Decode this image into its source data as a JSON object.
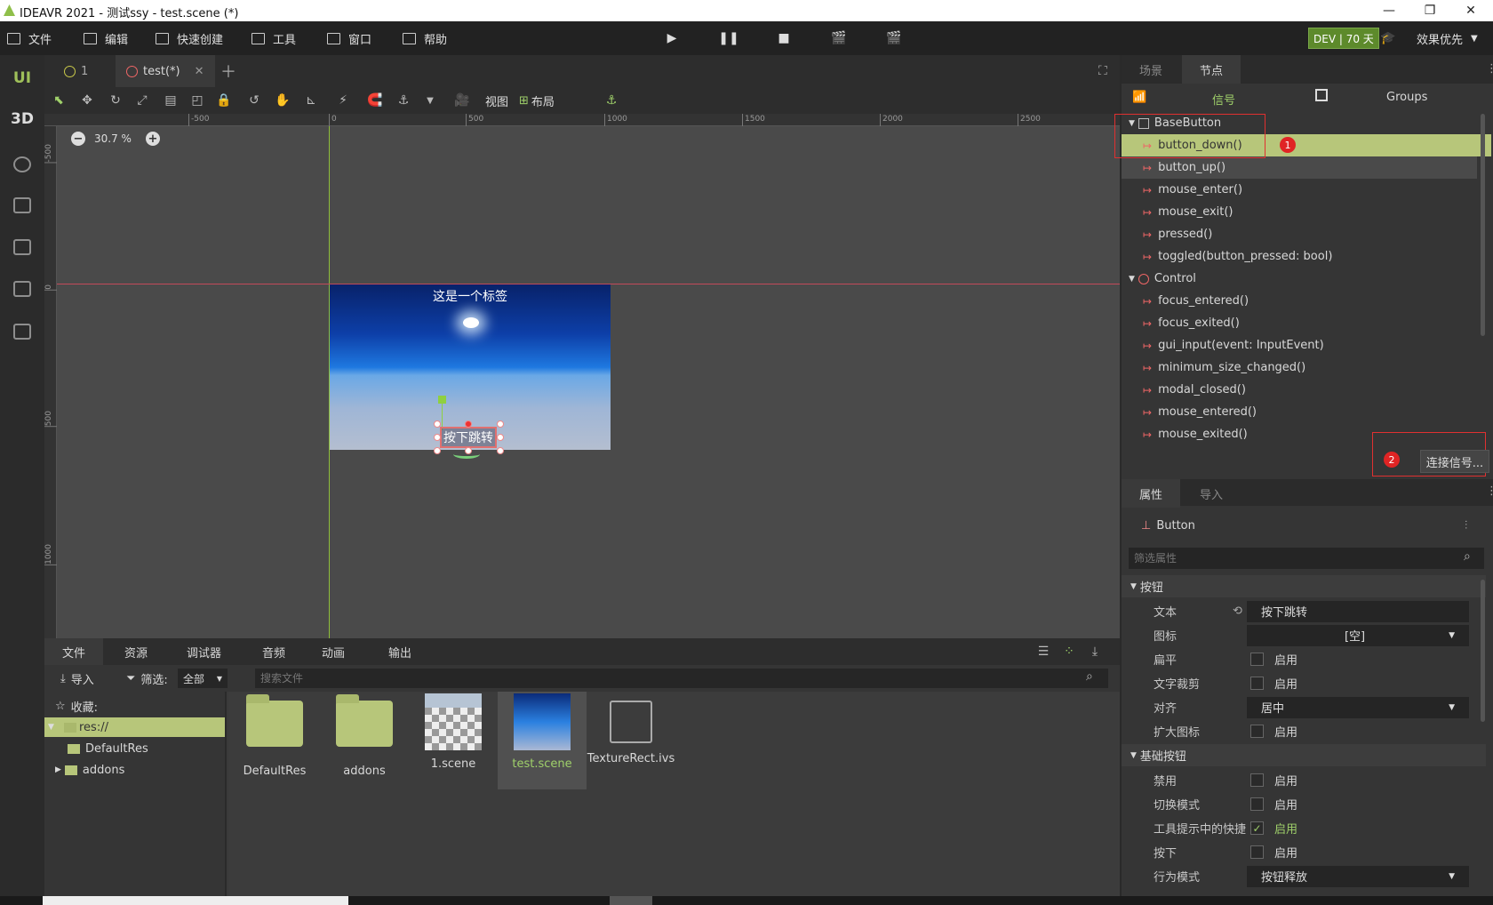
{
  "window": {
    "title": "IDEAVR 2021 - 测试ssy - test.scene (*)",
    "min": "—",
    "max": "❐",
    "close": "✕"
  },
  "menu": {
    "file": "文件",
    "edit": "编辑",
    "quick_create": "快速创建",
    "tools": "工具",
    "window": "窗口",
    "help": "帮助"
  },
  "dev_badge": "DEV | 70 天",
  "quality": "效果优先",
  "left_modes": {
    "ui": "UI",
    "three_d": "3D"
  },
  "tabs": [
    {
      "label": "1"
    },
    {
      "label": "test(*)"
    }
  ],
  "toolbar": {
    "view": "视图",
    "layout": "布局"
  },
  "viewport": {
    "zoom": "30.7 %",
    "ruler_top": [
      "-500",
      "0",
      "500",
      "1000",
      "1500",
      "2000",
      "2500"
    ],
    "ruler_left": [
      "-500",
      "0",
      "500",
      "1000"
    ],
    "label_text": "这是一个标签",
    "button_text": "按下跳转"
  },
  "bottom_tabs": [
    "文件",
    "资源",
    "调试器",
    "音频",
    "动画",
    "输出"
  ],
  "filesystem": {
    "import": "导入",
    "filter": "筛选:",
    "filter_value": "全部",
    "search_placeholder": "搜索文件",
    "favorites": "收藏:",
    "tree": [
      "res://",
      "DefaultRes",
      "addons"
    ],
    "files": [
      "DefaultRes",
      "addons",
      "1.scene",
      "test.scene",
      "TextureRect.ivs"
    ]
  },
  "right_tabs": {
    "scene": "场景",
    "node": "节点"
  },
  "signals_tab": {
    "signals": "信号",
    "groups": "Groups"
  },
  "signals": {
    "base_button": "BaseButton",
    "base_button_items": [
      "button_down()",
      "button_up()",
      "mouse_enter()",
      "mouse_exit()",
      "pressed()",
      "toggled(button_pressed: bool)"
    ],
    "control": "Control",
    "control_items": [
      "focus_entered()",
      "focus_exited()",
      "gui_input(event: InputEvent)",
      "minimum_size_changed()",
      "modal_closed()",
      "mouse_entered()",
      "mouse_exited()"
    ],
    "connect": "连接信号...",
    "badge1": "1",
    "badge2": "2"
  },
  "inspector": {
    "tab_props": "属性",
    "tab_import": "导入",
    "node_type": "Button",
    "filter_placeholder": "筛选属性",
    "sect_button": "按钮",
    "text_label": "文本",
    "text_value": "按下跳转",
    "icon_label": "图标",
    "icon_value": "[空]",
    "flat_label": "扁平",
    "clip_label": "文字裁剪",
    "align_label": "对齐",
    "align_value": "居中",
    "expand_label": "扩大图标",
    "sect_base": "基础按钮",
    "disabled_label": "禁用",
    "toggle_label": "切换模式",
    "shortcut_label": "工具提示中的快捷",
    "pressed_label": "按下",
    "action_label": "行为模式",
    "action_value": "按钮释放",
    "enable": "启用"
  }
}
